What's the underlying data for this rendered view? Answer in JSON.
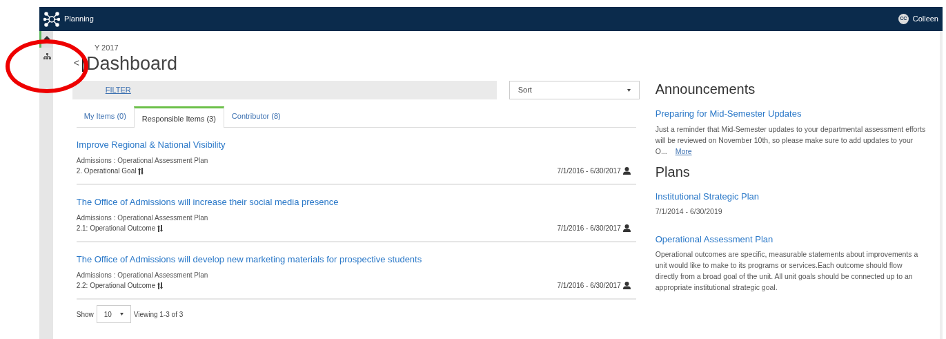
{
  "navbar": {
    "app_name": "Planning",
    "user": {
      "initials": "CC",
      "name": "Colleen"
    }
  },
  "sidebar": {
    "items": [
      {
        "kind": "home",
        "selected": true
      },
      {
        "kind": "hierarchy",
        "selected": false
      }
    ]
  },
  "header": {
    "back": "<",
    "subtitle": "Y 2017",
    "title": "Dashboard"
  },
  "filter": {
    "label": "FILTER"
  },
  "sort": {
    "value": "Sort"
  },
  "tabs": [
    {
      "label": "My Items (0)",
      "selected": false
    },
    {
      "label": "Responsible Items (3)",
      "selected": true
    },
    {
      "label": "Contributor (8)",
      "selected": false
    }
  ],
  "items": [
    {
      "title": "Improve Regional & National Visibility",
      "plan": "Admissions : Operational Assessment Plan",
      "type": "2. Operational Goal",
      "dates": "7/1/2016 - 6/30/2017"
    },
    {
      "title": "The Office of Admissions will increase their social media presence",
      "plan": "Admissions : Operational Assessment Plan",
      "type": "2.1: Operational Outcome",
      "dates": "7/1/2016 - 6/30/2017"
    },
    {
      "title": "The Office of Admissions will develop new marketing materials for prospective students",
      "plan": "Admissions : Operational Assessment Plan",
      "type": "2.2: Operational Outcome",
      "dates": "7/1/2016 - 6/30/2017"
    }
  ],
  "pagination": {
    "show": "Show",
    "page_size": "10",
    "viewing": "Viewing 1-3 of 3"
  },
  "announcements": {
    "heading": "Announcements",
    "items": [
      {
        "title": "Preparing for Mid-Semester Updates",
        "body": "Just a reminder that Mid-Semester updates to your departmental assessment efforts will be reviewed on November 10th, so please make sure to add updates to your O...",
        "more": "More"
      }
    ]
  },
  "plans": {
    "heading": "Plans",
    "items": [
      {
        "title": "Institutional Strategic Plan",
        "text": "7/1/2014 - 6/30/2019"
      },
      {
        "title": "Operational Assessment Plan",
        "text": "Operational outcomes are specific, measurable statements about improvements a unit would like to make to its programs or services.Each outcome should flow directly from a broad goal of the unit. All unit goals should be connected up to an appropriate institutional strategic goal."
      }
    ]
  },
  "annotation": {
    "kind": "circle"
  }
}
